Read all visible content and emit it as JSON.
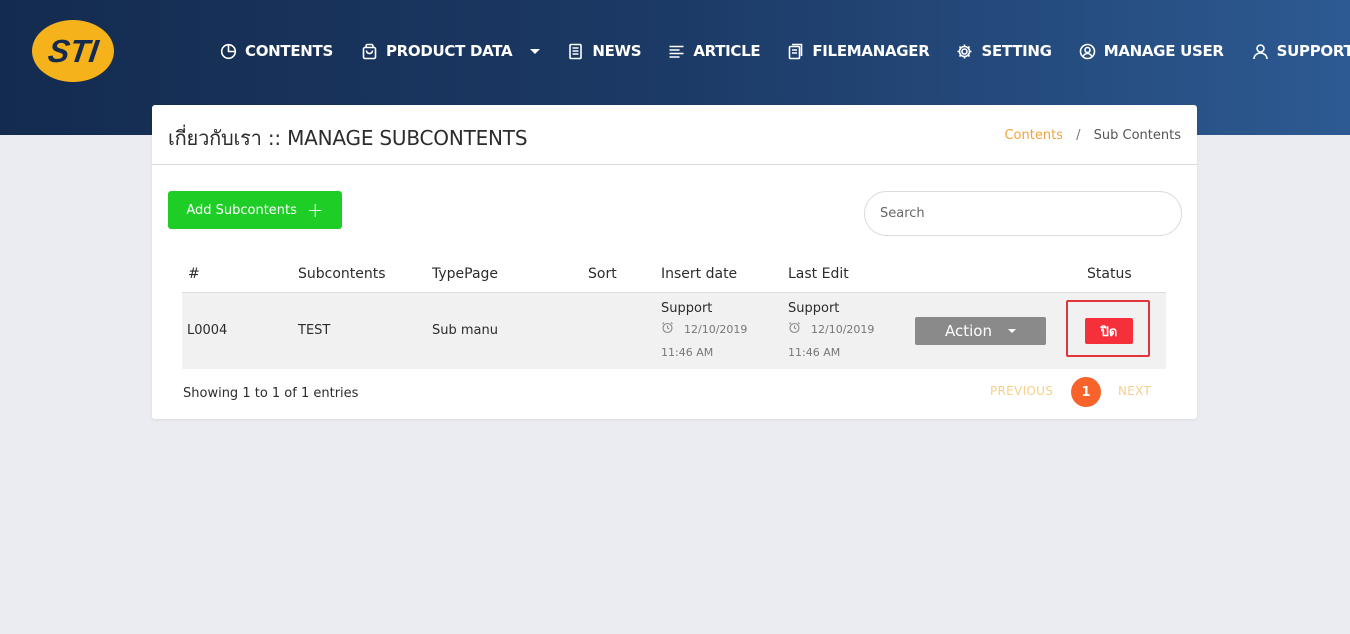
{
  "brand": {
    "logo_text": "STI",
    "logo_color": "#f6b21b"
  },
  "nav": [
    {
      "label": "CONTENTS",
      "icon": "pie-chart-icon"
    },
    {
      "label": "PRODUCT DATA",
      "icon": "shopping-bag-icon",
      "dropdown": true
    },
    {
      "label": "NEWS",
      "icon": "document-icon"
    },
    {
      "label": "ARTICLE",
      "icon": "text-lines-icon"
    },
    {
      "label": "FILEMANAGER",
      "icon": "files-icon"
    },
    {
      "label": "SETTING",
      "icon": "gear-icon"
    },
    {
      "label": "MANAGE USER",
      "icon": "user-circle-icon"
    },
    {
      "label": "SUPPORT",
      "icon": "user-icon",
      "dropdown": true
    }
  ],
  "page": {
    "title": "เกี่ยวกับเรา :: MANAGE SUBCONTENTS",
    "breadcrumb": {
      "link": "Contents",
      "separator": "/",
      "current": "Sub Contents"
    }
  },
  "toolbar": {
    "add_label": "Add Subcontents",
    "add_icon": "+",
    "search_placeholder": "Search"
  },
  "table": {
    "columns": [
      "#",
      "Subcontents",
      "TypePage",
      "Sort",
      "Insert date",
      "Last Edit",
      "",
      "Status"
    ],
    "rows": [
      {
        "id": "L0004",
        "subcontents": "TEST",
        "typepage": "Sub manu",
        "sort": "",
        "insert_by": "Support",
        "insert_date": "12/10/2019 11:46 AM",
        "edit_by": "Support",
        "edit_date": "12/10/2019 11:46 AM",
        "action_label": "Action",
        "status_label": "ปิด"
      }
    ]
  },
  "footer": {
    "showing": "Showing 1 to 1 of 1 entries",
    "prev": "PREVIOUS",
    "page": "1",
    "next": "NEXT"
  },
  "colors": {
    "header_gradient_start": "#142b4f",
    "header_gradient_end": "#2d5a92",
    "add_button": "#1fcd27",
    "status_button": "#f5303a",
    "highlight_border": "#e0363b",
    "pagination_active": "#f7632b",
    "breadcrumb_link": "#f0a33b"
  }
}
